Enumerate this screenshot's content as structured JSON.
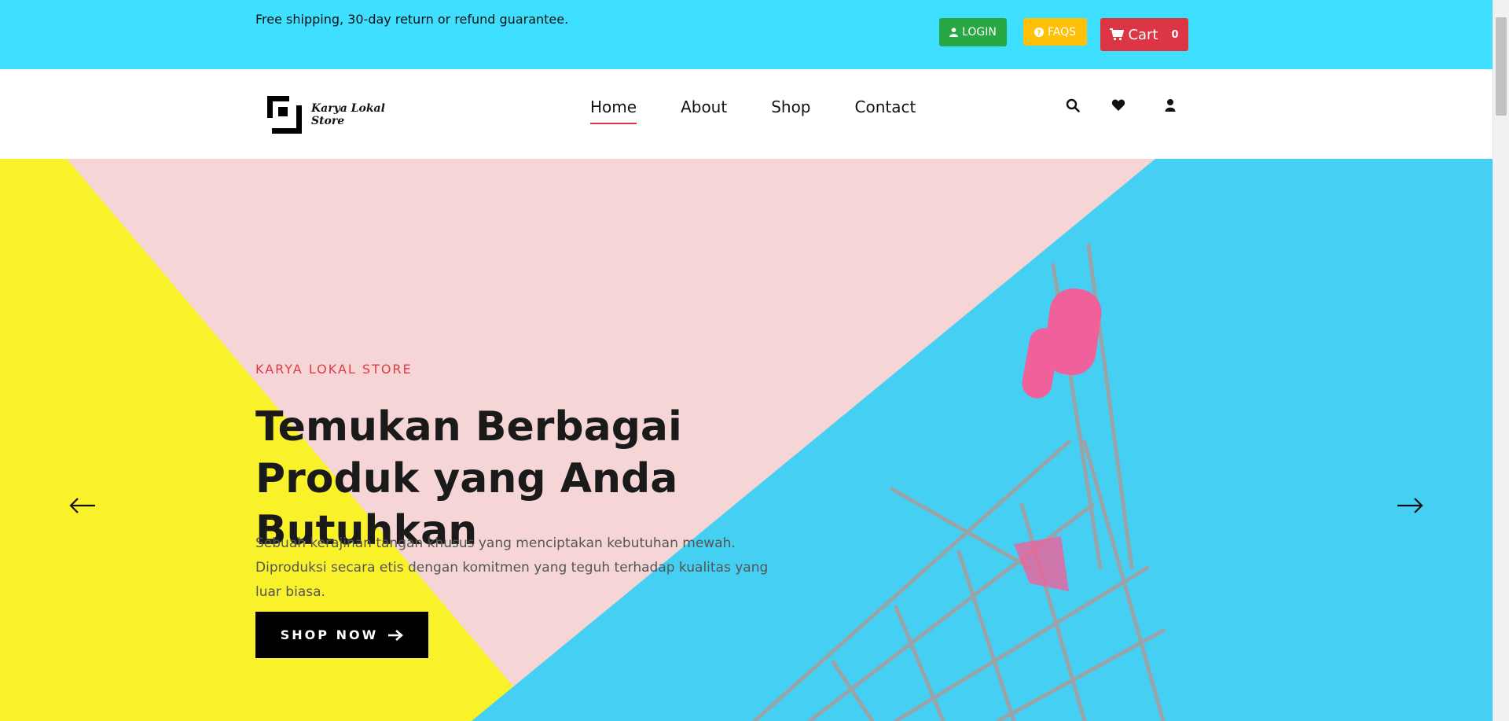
{
  "topbar": {
    "notice": "Free shipping, 30-day return or refund guarantee.",
    "login_label": "LOGIN",
    "faqs_label": "FAQS",
    "cart_label": "Cart",
    "cart_count": "0"
  },
  "header": {
    "logo_text": "Karya Lokal Store",
    "nav": [
      {
        "label": "Home",
        "active": true
      },
      {
        "label": "About",
        "active": false
      },
      {
        "label": "Shop",
        "active": false
      },
      {
        "label": "Contact",
        "active": false
      }
    ],
    "icons": [
      "search-icon",
      "heart-icon",
      "user-icon"
    ]
  },
  "hero": {
    "kicker": "KARYA LOKAL STORE",
    "title": "Temukan Berbagai Produk yang Anda Butuhkan",
    "description": "Sebuah kerajinan tangan khusus yang menciptakan kebutuhan mewah. Diproduksi secara etis dengan komitmen yang teguh terhadap kualitas yang luar biasa.",
    "cta_label": "SHOP NOW",
    "prev_icon": "arrow-left-icon",
    "next_icon": "arrow-right-icon"
  },
  "colors": {
    "topbar_bg": "#3fe0ff",
    "login": "#28a745",
    "faqs": "#ffc107",
    "cart": "#dc3545",
    "accent": "#e03a48",
    "hero_yellow": "#f9f22a",
    "hero_pink": "#f5d5d5",
    "hero_blue": "#45d0f3"
  }
}
